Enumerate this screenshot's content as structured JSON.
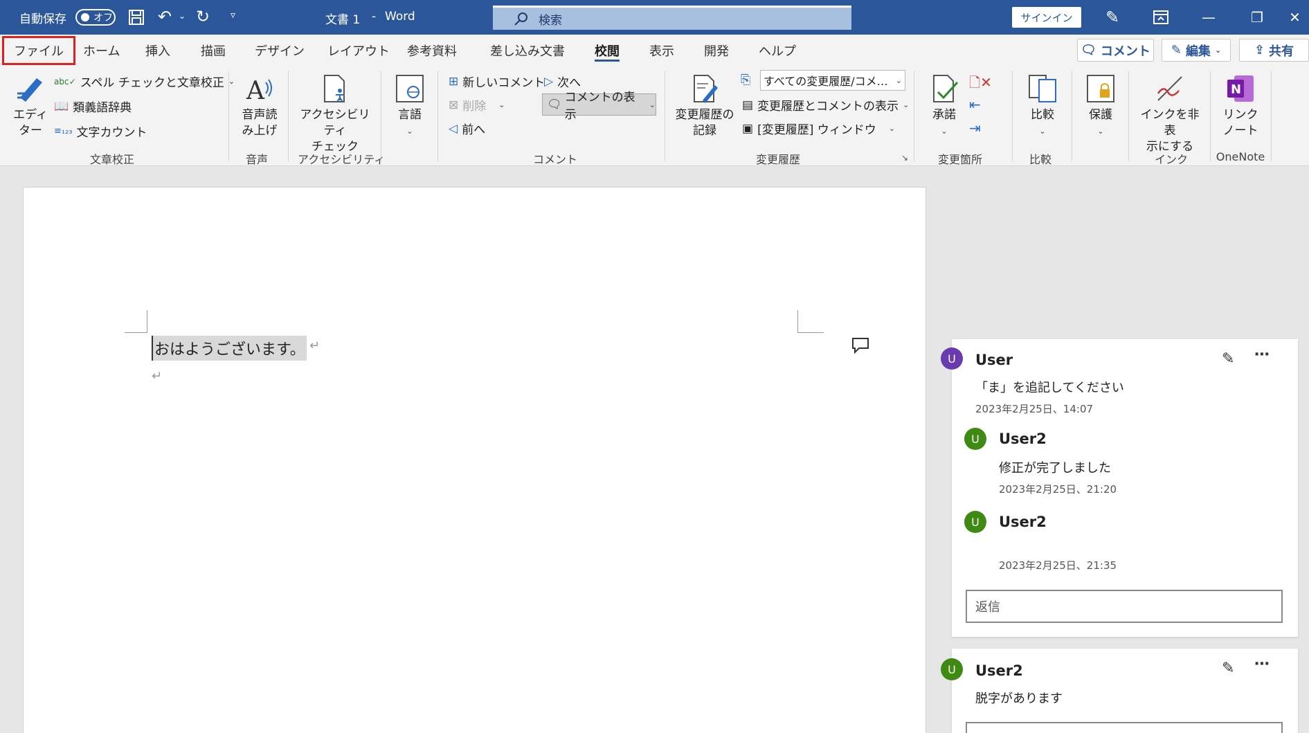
{
  "titlebar": {
    "autosave_label": "自動保存",
    "autosave_state": "オフ",
    "doc_title": "文書 1",
    "separator": "-",
    "app_name": "Word",
    "search_placeholder": "検索",
    "signin_label": "サインイン"
  },
  "tabs": [
    "ファイル",
    "ホーム",
    "挿入",
    "描画",
    "デザイン",
    "レイアウト",
    "参考資料",
    "差し込み文書",
    "校閲",
    "表示",
    "開発",
    "ヘルプ"
  ],
  "active_tab": "校閲",
  "right_buttons": {
    "comment": "コメント",
    "edit": "編集",
    "share": "共有"
  },
  "ribbon": {
    "proofing": {
      "editor_line1": "エディ",
      "editor_line2": "ター",
      "spell": "スペル チェックと文章校正",
      "thesaurus": "類義語辞典",
      "wordcount": "文字カウント",
      "label": "文章校正"
    },
    "speech": {
      "line1": "音声読",
      "line2": "み上げ",
      "label": "音声"
    },
    "accessibility": {
      "line1": "アクセシビリティ",
      "line2": "チェック",
      "label": "アクセシビリティ"
    },
    "language": {
      "line1": "言語"
    },
    "comments": {
      "new": "新しいコメント",
      "delete": "削除",
      "prev": "前へ",
      "next": "次へ",
      "show": "コメントの表示",
      "label": "コメント"
    },
    "tracking": {
      "track_line1": "変更履歴の",
      "track_line2": "記録",
      "all_markup": "すべての変更履歴/コメ…",
      "show_markup": "変更履歴とコメントの表示",
      "pane": "[変更履歴] ウィンドウ",
      "label": "変更履歴"
    },
    "changes": {
      "accept": "承諾",
      "label": "変更箇所"
    },
    "compare": {
      "line1": "比較",
      "label": "比較"
    },
    "protect": {
      "line1": "保護"
    },
    "ink": {
      "line1": "インクを非表",
      "line2": "示にする",
      "label": "インク"
    },
    "onenote": {
      "line1": "リンク",
      "line2": "ノート",
      "label": "OneNote"
    }
  },
  "document": {
    "text": "おはようございます。"
  },
  "comments": [
    {
      "author": "User",
      "initial": "U",
      "text": "「ま」を追記してください",
      "date": "2023年2月25日、14:07",
      "replies": [
        {
          "author": "User2",
          "initial": "U",
          "text": "修正が完了しました",
          "date": "2023年2月25日、21:20"
        },
        {
          "author": "User2",
          "initial": "U",
          "text": "",
          "date": "2023年2月25日、21:35"
        }
      ],
      "reply_placeholder": "返信"
    },
    {
      "author": "User2",
      "initial": "U",
      "text": "脱字があります"
    }
  ],
  "colors": {
    "title_bar": "#2b579a",
    "avatar_user": "#6a3bb0",
    "avatar_user2": "#3f8a12",
    "highlight_border": "#e02020"
  }
}
